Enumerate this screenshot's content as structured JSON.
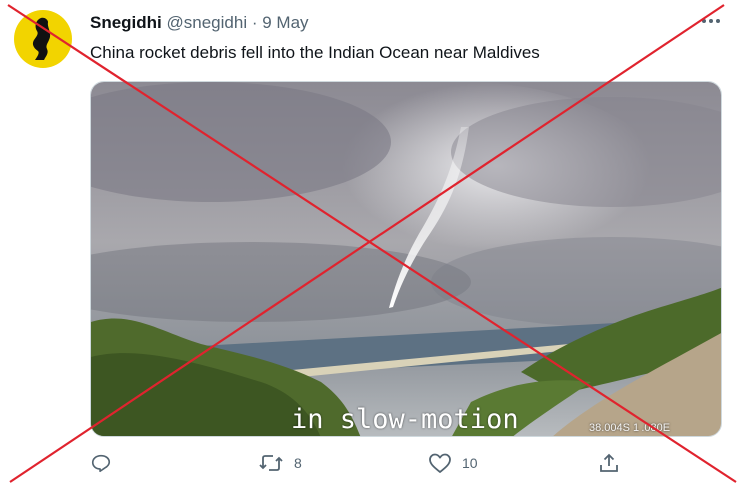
{
  "tweet": {
    "author_name": "Snegidhi",
    "author_handle": "@snegidhi",
    "separator": "·",
    "date": "9 May",
    "text": "China rocket debris fell into the Indian Ocean near Maldives",
    "media": {
      "caption": "in slow-motion",
      "coordinates": "38.004S 1 .080E"
    },
    "actions": {
      "reply_count": "",
      "retweet_count": "8",
      "like_count": "10"
    }
  },
  "overlay": {
    "type": "red-x-cross",
    "color": "#e0232e"
  },
  "icons": [
    "avatar-silhouette-icon",
    "more-dots-icon",
    "reply-icon",
    "retweet-icon",
    "like-icon",
    "share-icon"
  ],
  "colors": {
    "text_primary": "#0f1419",
    "text_secondary": "#536471",
    "avatar_bg": "#f2d400"
  }
}
